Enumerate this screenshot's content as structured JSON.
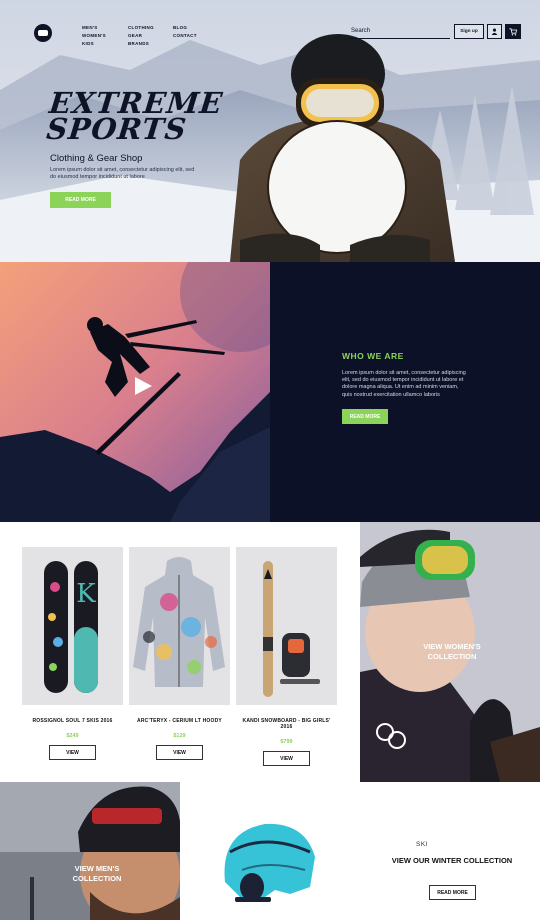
{
  "nav": {
    "col1": [
      "MEN'S",
      "WOMEN'S",
      "KIDS"
    ],
    "col2": [
      "CLOTHING",
      "GEAR",
      "BRANDS"
    ],
    "col3": [
      "BLOG",
      "CONTACT"
    ],
    "search_placeholder": "Search",
    "signup_label": "Sign up",
    "user_icon": "user-icon",
    "cart_icon": "cart-icon"
  },
  "hero": {
    "title_line1": "EXTREME",
    "title_line2": "SPORTS",
    "subtitle": "Clothing & Gear Shop",
    "text": "Lorem ipsum dolor sit amet, consectetur adipiscing elit, sed do eiusmod tempor incididunt ut labore",
    "button": "READ MORE"
  },
  "about": {
    "title": "WHO WE ARE",
    "text": "Lorem ipsum dolor sit amet, consectetur adipiscing elit, sed do eiusmod tempor incididunt ut labore et dolore magna aliqua. Ut enim ad minim veniam, quis nostrud exercitation ullamco laboris",
    "button": "READ MORE"
  },
  "products": [
    {
      "name": "ROSSIGNOL SOUL 7 SKIS 2016",
      "price": "$249",
      "button": "VIEW"
    },
    {
      "name": "ARC'TERYX - CERIUM LT HOODY",
      "price": "$129",
      "button": "VIEW"
    },
    {
      "name": "KANDI SNOWBOARD - BIG GIRLS' 2016",
      "price": "$799",
      "button": "VIEW"
    }
  ],
  "collections": {
    "women": "VIEW WOMEN'S COLLECTION",
    "men": "VIEW MEN'S COLLECTION",
    "winter_pre": "SKI",
    "winter_title": "VIEW OUR WINTER COLLECTION",
    "winter_button": "READ MORE"
  },
  "colors": {
    "accent": "#8cd35a",
    "navy": "#0d1128"
  }
}
